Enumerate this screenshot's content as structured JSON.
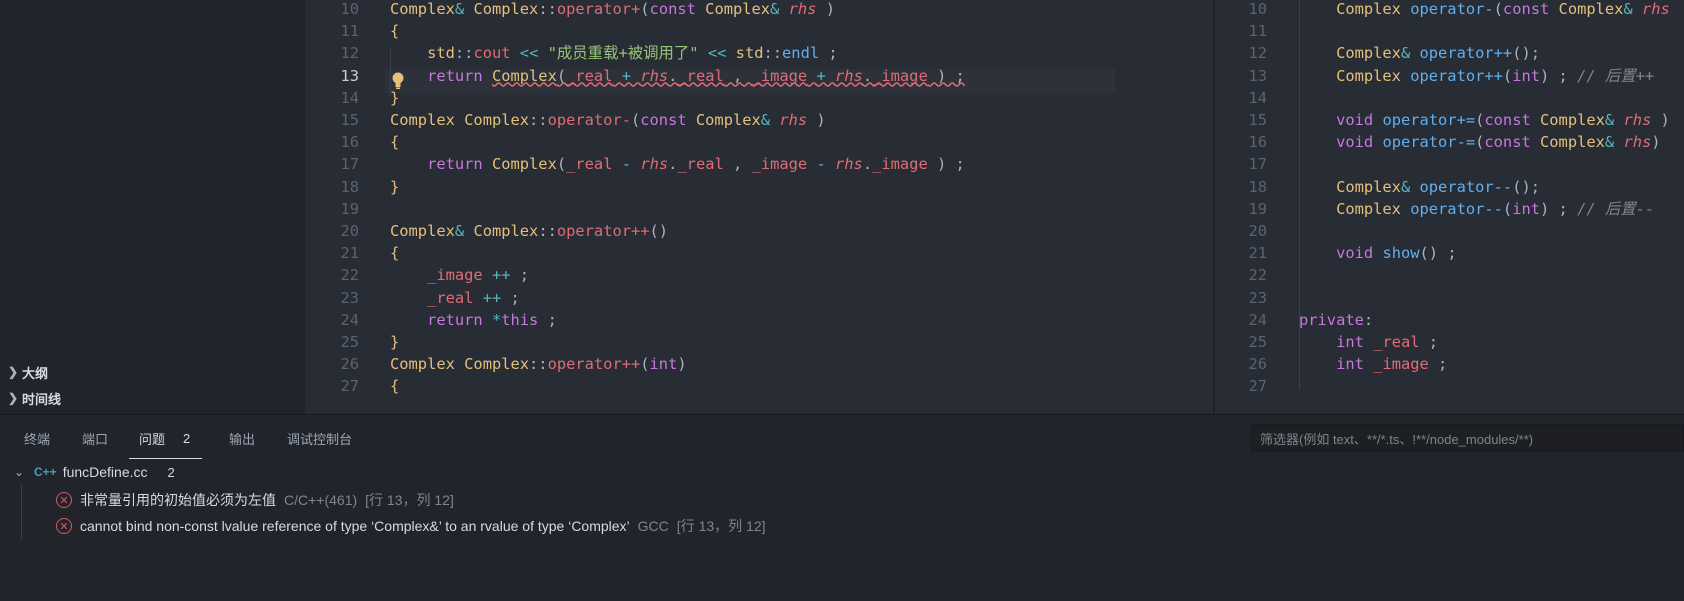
{
  "sidebar": {
    "sections": [
      {
        "label": "大纲"
      },
      {
        "label": "时间线"
      }
    ]
  },
  "editor_left": {
    "lines": [
      {
        "n": "10",
        "tokens": [
          [
            "t",
            "Complex"
          ],
          [
            "o",
            "&"
          ],
          [
            "n",
            " "
          ],
          [
            "t",
            "Complex"
          ],
          [
            "n",
            "::"
          ],
          [
            "fn",
            "operator+"
          ],
          [
            "n",
            "("
          ],
          [
            "k",
            "const"
          ],
          [
            "n",
            " "
          ],
          [
            "t",
            "Complex"
          ],
          [
            "o",
            "&"
          ],
          [
            "n",
            " "
          ],
          [
            "i",
            "rhs"
          ],
          [
            "n",
            " )"
          ]
        ]
      },
      {
        "n": "11",
        "tokens": [
          [
            "t",
            "{"
          ]
        ]
      },
      {
        "n": "12",
        "tokens": [
          [
            "n",
            "    "
          ],
          [
            "t",
            "std"
          ],
          [
            "n",
            "::"
          ],
          [
            "fn",
            "cout"
          ],
          [
            "n",
            " "
          ],
          [
            "o",
            "<<"
          ],
          [
            "n",
            " "
          ],
          [
            "s",
            "\"成员重载+被调用了\""
          ],
          [
            "n",
            " "
          ],
          [
            "o",
            "<<"
          ],
          [
            "n",
            " "
          ],
          [
            "t",
            "std"
          ],
          [
            "n",
            "::"
          ],
          [
            "f",
            "endl"
          ],
          [
            "n",
            " ;"
          ]
        ]
      },
      {
        "n": "13",
        "tokens": [
          [
            "n",
            "    "
          ],
          [
            "k",
            "return"
          ],
          [
            "n",
            " "
          ],
          [
            "t",
            "Complex"
          ],
          [
            "n",
            "("
          ],
          [
            "p",
            "_real"
          ],
          [
            "n",
            " "
          ],
          [
            "o",
            "+"
          ],
          [
            "n",
            " "
          ],
          [
            "i",
            "rhs"
          ],
          [
            "n",
            "."
          ],
          [
            "p",
            "_real"
          ],
          [
            "n",
            " , "
          ],
          [
            "p",
            "_image"
          ],
          [
            "n",
            " "
          ],
          [
            "o",
            "+"
          ],
          [
            "n",
            " "
          ],
          [
            "i",
            "rhs"
          ],
          [
            "n",
            "."
          ],
          [
            "p",
            "_image"
          ],
          [
            "n",
            " ) ;"
          ]
        ],
        "active": true,
        "squiggle": true
      },
      {
        "n": "14",
        "tokens": [
          [
            "t",
            "}"
          ]
        ]
      },
      {
        "n": "15",
        "tokens": [
          [
            "t",
            "Complex"
          ],
          [
            "n",
            " "
          ],
          [
            "t",
            "Complex"
          ],
          [
            "n",
            "::"
          ],
          [
            "fn",
            "operator-"
          ],
          [
            "n",
            "("
          ],
          [
            "k",
            "const"
          ],
          [
            "n",
            " "
          ],
          [
            "t",
            "Complex"
          ],
          [
            "o",
            "&"
          ],
          [
            "n",
            " "
          ],
          [
            "i",
            "rhs"
          ],
          [
            "n",
            " )"
          ]
        ]
      },
      {
        "n": "16",
        "tokens": [
          [
            "t",
            "{"
          ]
        ]
      },
      {
        "n": "17",
        "tokens": [
          [
            "n",
            "    "
          ],
          [
            "k",
            "return"
          ],
          [
            "n",
            " "
          ],
          [
            "t",
            "Complex"
          ],
          [
            "n",
            "("
          ],
          [
            "p",
            "_real"
          ],
          [
            "n",
            " "
          ],
          [
            "o",
            "-"
          ],
          [
            "n",
            " "
          ],
          [
            "i",
            "rhs"
          ],
          [
            "n",
            "."
          ],
          [
            "p",
            "_real"
          ],
          [
            "n",
            " , "
          ],
          [
            "p",
            "_image"
          ],
          [
            "n",
            " "
          ],
          [
            "o",
            "-"
          ],
          [
            "n",
            " "
          ],
          [
            "i",
            "rhs"
          ],
          [
            "n",
            "."
          ],
          [
            "p",
            "_image"
          ],
          [
            "n",
            " ) ;"
          ]
        ]
      },
      {
        "n": "18",
        "tokens": [
          [
            "t",
            "}"
          ]
        ]
      },
      {
        "n": "19",
        "tokens": []
      },
      {
        "n": "20",
        "tokens": [
          [
            "t",
            "Complex"
          ],
          [
            "o",
            "&"
          ],
          [
            "n",
            " "
          ],
          [
            "t",
            "Complex"
          ],
          [
            "n",
            "::"
          ],
          [
            "fn",
            "operator++"
          ],
          [
            "n",
            "()"
          ]
        ]
      },
      {
        "n": "21",
        "tokens": [
          [
            "t",
            "{"
          ]
        ]
      },
      {
        "n": "22",
        "tokens": [
          [
            "n",
            "    "
          ],
          [
            "p",
            "_image"
          ],
          [
            "n",
            " "
          ],
          [
            "o",
            "++"
          ],
          [
            "n",
            " ;"
          ]
        ]
      },
      {
        "n": "23",
        "tokens": [
          [
            "n",
            "    "
          ],
          [
            "p",
            "_real"
          ],
          [
            "n",
            " "
          ],
          [
            "o",
            "++"
          ],
          [
            "n",
            " ;"
          ]
        ]
      },
      {
        "n": "24",
        "tokens": [
          [
            "n",
            "    "
          ],
          [
            "k",
            "return"
          ],
          [
            "n",
            " "
          ],
          [
            "o",
            "*"
          ],
          [
            "k",
            "this"
          ],
          [
            "n",
            " ;"
          ]
        ]
      },
      {
        "n": "25",
        "tokens": [
          [
            "t",
            "}"
          ]
        ]
      },
      {
        "n": "26",
        "tokens": [
          [
            "t",
            "Complex"
          ],
          [
            "n",
            " "
          ],
          [
            "t",
            "Complex"
          ],
          [
            "n",
            "::"
          ],
          [
            "fn",
            "operator++"
          ],
          [
            "n",
            "("
          ],
          [
            "k",
            "int"
          ],
          [
            "n",
            ")"
          ]
        ]
      },
      {
        "n": "27",
        "tokens": [
          [
            "t",
            "{"
          ]
        ]
      }
    ]
  },
  "editor_right": {
    "lines": [
      {
        "n": "10",
        "tokens": [
          [
            "n",
            "    "
          ],
          [
            "t",
            "Complex"
          ],
          [
            "n",
            " "
          ],
          [
            "f",
            "operator-"
          ],
          [
            "n",
            "("
          ],
          [
            "k",
            "const"
          ],
          [
            "n",
            " "
          ],
          [
            "t",
            "Complex"
          ],
          [
            "o",
            "&"
          ],
          [
            "n",
            " "
          ],
          [
            "i",
            "rhs"
          ]
        ]
      },
      {
        "n": "11",
        "tokens": []
      },
      {
        "n": "12",
        "tokens": [
          [
            "n",
            "    "
          ],
          [
            "t",
            "Complex"
          ],
          [
            "o",
            "&"
          ],
          [
            "n",
            " "
          ],
          [
            "f",
            "operator++"
          ],
          [
            "n",
            "();"
          ]
        ]
      },
      {
        "n": "13",
        "tokens": [
          [
            "n",
            "    "
          ],
          [
            "t",
            "Complex"
          ],
          [
            "n",
            " "
          ],
          [
            "f",
            "operator++"
          ],
          [
            "n",
            "("
          ],
          [
            "k",
            "int"
          ],
          [
            "n",
            ") ; "
          ],
          [
            "c",
            "// 后置++"
          ]
        ]
      },
      {
        "n": "14",
        "tokens": []
      },
      {
        "n": "15",
        "tokens": [
          [
            "n",
            "    "
          ],
          [
            "k",
            "void"
          ],
          [
            "n",
            " "
          ],
          [
            "f",
            "operator+="
          ],
          [
            "n",
            "("
          ],
          [
            "k",
            "const"
          ],
          [
            "n",
            " "
          ],
          [
            "t",
            "Complex"
          ],
          [
            "o",
            "&"
          ],
          [
            "n",
            " "
          ],
          [
            "i",
            "rhs"
          ],
          [
            "n",
            " )"
          ]
        ]
      },
      {
        "n": "16",
        "tokens": [
          [
            "n",
            "    "
          ],
          [
            "k",
            "void"
          ],
          [
            "n",
            " "
          ],
          [
            "f",
            "operator-="
          ],
          [
            "n",
            "("
          ],
          [
            "k",
            "const"
          ],
          [
            "n",
            " "
          ],
          [
            "t",
            "Complex"
          ],
          [
            "o",
            "&"
          ],
          [
            "n",
            " "
          ],
          [
            "i",
            "rhs"
          ],
          [
            "n",
            ")"
          ]
        ]
      },
      {
        "n": "17",
        "tokens": []
      },
      {
        "n": "18",
        "tokens": [
          [
            "n",
            "    "
          ],
          [
            "t",
            "Complex"
          ],
          [
            "o",
            "&"
          ],
          [
            "n",
            " "
          ],
          [
            "f",
            "operator--"
          ],
          [
            "n",
            "();"
          ]
        ]
      },
      {
        "n": "19",
        "tokens": [
          [
            "n",
            "    "
          ],
          [
            "t",
            "Complex"
          ],
          [
            "n",
            " "
          ],
          [
            "f",
            "operator--"
          ],
          [
            "n",
            "("
          ],
          [
            "k",
            "int"
          ],
          [
            "n",
            ") ; "
          ],
          [
            "c",
            "// 后置--"
          ]
        ]
      },
      {
        "n": "20",
        "tokens": []
      },
      {
        "n": "21",
        "tokens": [
          [
            "n",
            "    "
          ],
          [
            "k",
            "void"
          ],
          [
            "n",
            " "
          ],
          [
            "f",
            "show"
          ],
          [
            "n",
            "() ;"
          ]
        ]
      },
      {
        "n": "22",
        "tokens": []
      },
      {
        "n": "23",
        "tokens": []
      },
      {
        "n": "24",
        "tokens": [
          [
            "k",
            "private"
          ],
          [
            "n",
            ":"
          ]
        ]
      },
      {
        "n": "25",
        "tokens": [
          [
            "n",
            "    "
          ],
          [
            "k",
            "int"
          ],
          [
            "n",
            " "
          ],
          [
            "p",
            "_real"
          ],
          [
            "n",
            " ;"
          ]
        ]
      },
      {
        "n": "26",
        "tokens": [
          [
            "n",
            "    "
          ],
          [
            "k",
            "int"
          ],
          [
            "n",
            " "
          ],
          [
            "p",
            "_image"
          ],
          [
            "n",
            " ;"
          ]
        ]
      },
      {
        "n": "27",
        "tokens": []
      }
    ]
  },
  "panel": {
    "tabs": [
      {
        "label": "终端"
      },
      {
        "label": "端口"
      },
      {
        "label": "问题",
        "badge": "2"
      },
      {
        "label": "输出"
      },
      {
        "label": "调试控制台"
      }
    ],
    "filter_placeholder": "筛选器(例如 text、**/*.ts、!**/node_modules/**)",
    "file": {
      "icon": "C++",
      "name": "funcDefine.cc",
      "count": "2"
    },
    "problems": [
      {
        "message": "非常量引用的初始值必须为左值",
        "source": "C/C++(461)",
        "position": "[行 13，列 12]"
      },
      {
        "message": "cannot bind non-const lvalue reference of type ‘Complex&’ to an rvalue of type ‘Complex’",
        "source": "GCC",
        "position": "[行 13，列 12]"
      }
    ]
  },
  "colors": {
    "error": "#e05561",
    "keyword": "#c678dd",
    "type": "#e5c07b",
    "string": "#98c379"
  }
}
